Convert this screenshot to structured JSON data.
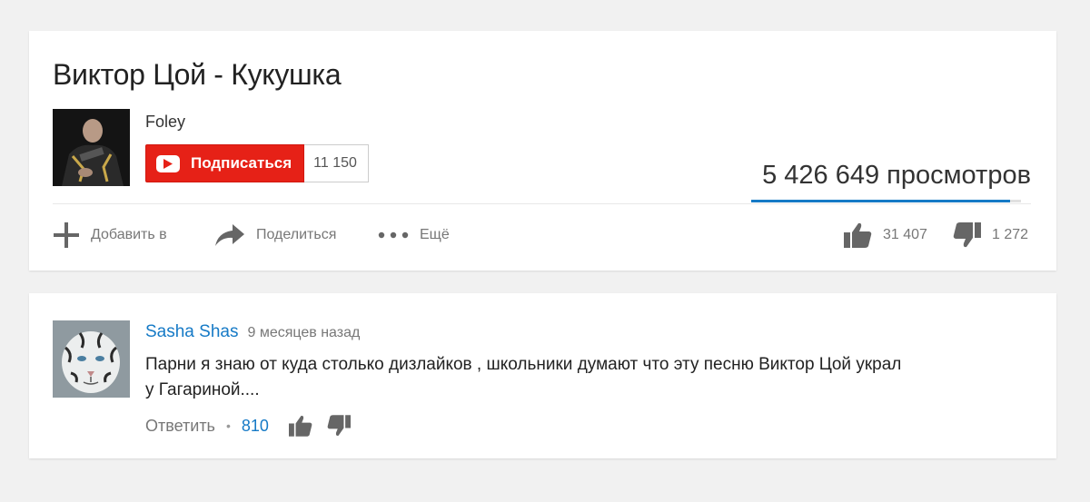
{
  "video": {
    "title": "Виктор Цой - Кукушка",
    "channel": {
      "name": "Foley",
      "subscribe_label": "Подписаться",
      "subscriber_count": "11 150"
    },
    "views": "5 426 649 просмотров",
    "like_ratio": 0.96,
    "actions": {
      "add_label": "Добавить в",
      "share_label": "Поделиться",
      "more_label": "Ещё"
    },
    "likes": "31 407",
    "dislikes": "1 272"
  },
  "comment": {
    "author": "Sasha Shas",
    "time": "9 месяцев назад",
    "text_line1": "Парни я знаю от куда столько дизлайков , школьники думают что эту песню Виктор Цой украл",
    "text_line2": "у Гагариной....",
    "reply_label": "Ответить",
    "separator": "•",
    "likes": "810"
  },
  "colors": {
    "accent": "#167ac6",
    "subscribe": "#e62117",
    "background": "#f1f1f1"
  },
  "icons": [
    "youtube-play-icon",
    "plus-icon",
    "share-arrow-icon",
    "more-dots-icon",
    "thumbs-up-icon",
    "thumbs-down-icon"
  ]
}
